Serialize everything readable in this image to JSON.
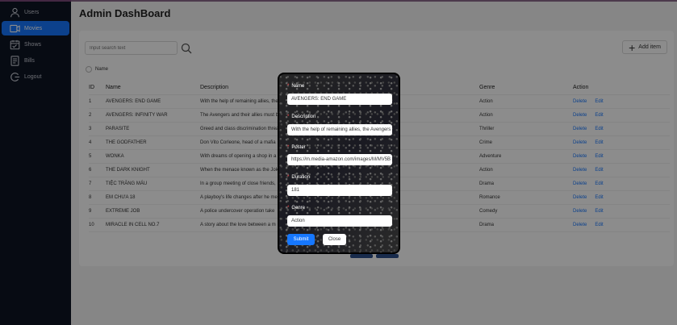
{
  "sidebar": {
    "items": [
      {
        "label": "Users",
        "icon": "user-icon",
        "active": false
      },
      {
        "label": "Movies",
        "icon": "movie-icon",
        "active": true
      },
      {
        "label": "Shows",
        "icon": "calendar-icon",
        "active": false
      },
      {
        "label": "Bills",
        "icon": "bill-icon",
        "active": false
      },
      {
        "label": "Logout",
        "icon": "logout-icon",
        "active": false
      }
    ]
  },
  "header": {
    "title": "Admin DashBoard"
  },
  "toolbar": {
    "search_placeholder": "Input search text",
    "add_label": "Add item",
    "filter_label": "Name"
  },
  "table": {
    "columns": [
      "ID",
      "Name",
      "Description",
      "Genre",
      "Action"
    ],
    "rows": [
      {
        "id": "1",
        "name": "AVENGERS: END GAME",
        "desc": "With the help of remaining allies, the",
        "genre": "Action"
      },
      {
        "id": "2",
        "name": "AVENGERS: INFINITY WAR",
        "desc": "The Avengers and their allies must b",
        "genre": "Action"
      },
      {
        "id": "3",
        "name": "PARASITE",
        "desc": "Greed and class discrimination threa",
        "genre": "Thriller"
      },
      {
        "id": "4",
        "name": "THE GODFATHER",
        "desc": "Don Vito Corleone, head of a mafia",
        "genre": "Crime"
      },
      {
        "id": "5",
        "name": "WONKA",
        "desc": "With dreams of opening a shop in a",
        "genre": "Adventure"
      },
      {
        "id": "6",
        "name": "THE DARK KNIGHT",
        "desc": "When the menace known as the Jok",
        "genre": "Action"
      },
      {
        "id": "7",
        "name": "TIỆC TRĂNG MÁU",
        "desc": "In a group meeting of close friends,",
        "genre": "Drama"
      },
      {
        "id": "8",
        "name": "EM CHƯA 18",
        "desc": "A playboy's life changes after he me",
        "genre": "Romance"
      },
      {
        "id": "9",
        "name": "EXTREME JOB",
        "desc": "A police undercover operation take",
        "genre": "Comedy"
      },
      {
        "id": "10",
        "name": "MIRACLE IN CELL NO.7",
        "desc": "A story about the love between a m",
        "genre": "Drama"
      }
    ],
    "delete_label": "Delete",
    "edit_label": "Edit"
  },
  "modal": {
    "fields": [
      {
        "label": "Name",
        "value": "AVENGERS: END GAME"
      },
      {
        "label": "Description",
        "value": "With the help of remaining allies, the Avengers"
      },
      {
        "label": "Poster",
        "value": "https://m.media-amazon.com/images/M/MV5B"
      },
      {
        "label": "Duration",
        "value": "181"
      },
      {
        "label": "Genre",
        "value": "Action"
      }
    ],
    "submit_label": "Submit",
    "close_label": "Close"
  },
  "colors": {
    "accent": "#1677ff",
    "sidebar_bg": "#0d1424",
    "required": "#ff4d4f"
  }
}
